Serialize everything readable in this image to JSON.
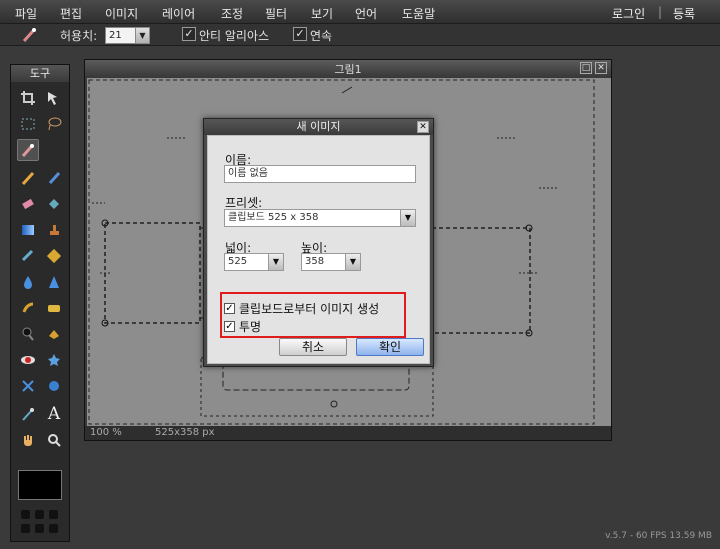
{
  "menu": {
    "items": [
      "파일",
      "편집",
      "이미지",
      "레이어",
      "조정",
      "필터",
      "보기",
      "언어",
      "도움말"
    ],
    "login": "로그인",
    "separator": "|",
    "register": "등록"
  },
  "options": {
    "tolerance_label": "허용치:",
    "tolerance_value": "21",
    "antialias_label": "안티 알리아스",
    "continuous_label": "연속",
    "check_mark": "✓"
  },
  "tools": {
    "title": "도구"
  },
  "image_window": {
    "title": "그림1",
    "zoom": "100 %",
    "size": "525x358 px"
  },
  "dialog": {
    "title": "새 이미지",
    "name_label": "이름:",
    "name_value": "이름 없음",
    "preset_label": "프리셋:",
    "preset_value": "클립보드 525 x 358",
    "width_label": "넓이:",
    "width_value": "525",
    "height_label": "높이:",
    "height_value": "358",
    "clipboard_label": "클립보드로부터 이미지 생성",
    "transparent_label": "투명",
    "cancel_label": "취소",
    "ok_label": "확인",
    "close_glyph": "✕",
    "highlight_color": "#e01b1b"
  },
  "status": {
    "text": "v.5.7 - 60 FPS 13.59 MB"
  }
}
